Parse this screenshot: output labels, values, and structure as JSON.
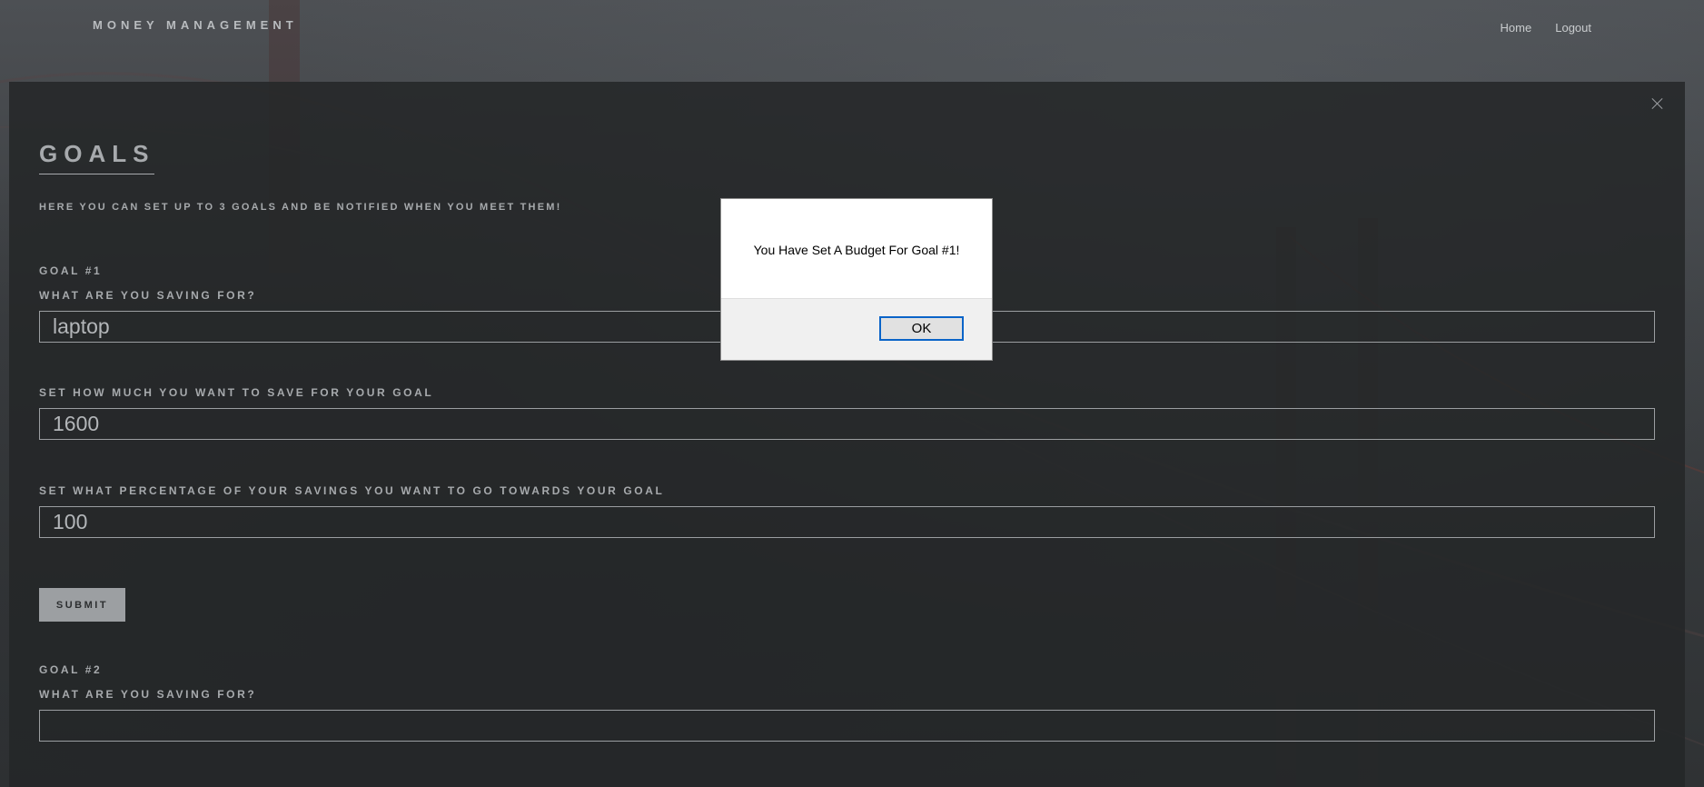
{
  "header": {
    "brand": "MONEY MANAGEMENT",
    "nav": [
      "Home",
      "Logout"
    ]
  },
  "goals": {
    "title": "GOALS",
    "subtitle": "HERE YOU CAN SET UP TO 3 GOALS AND BE NOTIFIED WHEN YOU MEET THEM!",
    "goal1": {
      "heading": "GOAL #1",
      "saving_for_label": "WHAT ARE YOU SAVING FOR?",
      "saving_for_value": "laptop",
      "amount_label": "SET HOW MUCH YOU WANT TO SAVE FOR YOUR GOAL",
      "amount_value": "1600",
      "percent_label": "SET WHAT PERCENTAGE OF YOUR SAVINGS YOU WANT TO GO TOWARDS YOUR GOAL",
      "percent_value": "100",
      "submit_label": "SUBMIT"
    },
    "goal2": {
      "heading": "GOAL #2",
      "saving_for_label": "WHAT ARE YOU SAVING FOR?",
      "saving_for_value": ""
    }
  },
  "alert": {
    "message": "You Have Set A Budget For Goal #1!",
    "ok_label": "OK"
  }
}
